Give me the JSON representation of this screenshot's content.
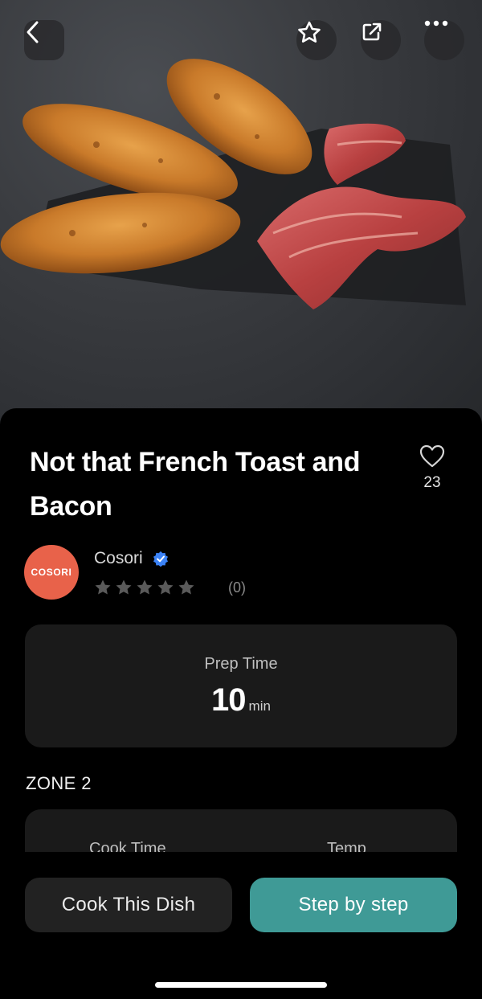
{
  "recipe": {
    "title": "Not that French Toast and Bacon",
    "likes": "23",
    "author": "Cosori",
    "avatar_text": "COSORI",
    "rating_count": "(0)",
    "stars": 5
  },
  "prep": {
    "label": "Prep Time",
    "value": "10",
    "unit": "min"
  },
  "zone": {
    "title": "ZONE 2",
    "cook_time_label": "Cook Time",
    "temp_label": "Temp"
  },
  "actions": {
    "cook_label": "Cook This Dish",
    "step_label": "Step by step"
  },
  "colors": {
    "accent": "#3f9a96",
    "avatar": "#e8624a",
    "verified": "#3b82f6"
  },
  "icons": {
    "back": "chevron-left-icon",
    "favorite": "star-outline-icon",
    "share": "share-icon",
    "more": "ellipsis-icon",
    "like": "heart-outline-icon",
    "verified": "verified-badge-icon"
  }
}
